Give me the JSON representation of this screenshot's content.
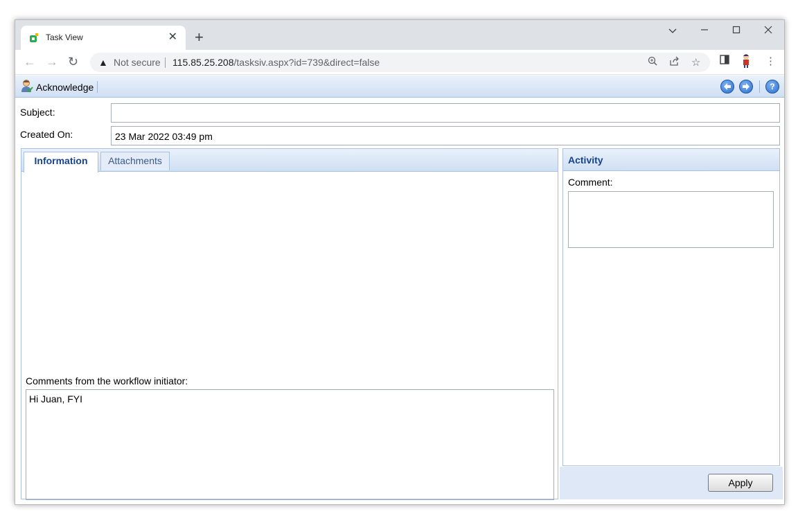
{
  "browser": {
    "tab_title": "Task View",
    "tab_close": "✕",
    "new_tab": "+",
    "security_label": "Not secure",
    "url_host": "115.85.25.208",
    "url_path": "/tasksiv.aspx?id=739&direct=false"
  },
  "toolbar": {
    "acknowledge_label": "Acknowledge"
  },
  "form": {
    "subject_label": "Subject:",
    "subject_value": "",
    "created_label": "Created On:",
    "created_value": "23 Mar 2022 03:49 pm"
  },
  "tabs": [
    {
      "label": "Information",
      "active": true
    },
    {
      "label": "Attachments",
      "active": false
    }
  ],
  "information": {
    "comments_label": "Comments from the workflow initiator:",
    "comments_value": "Hi Juan, FYI"
  },
  "activity": {
    "title": "Activity",
    "comment_label": "Comment:",
    "comment_value": "",
    "apply_label": "Apply"
  },
  "colors": {
    "accent": "#15428b",
    "panel_border": "#a9c0de",
    "header_gradient_top": "#eaf1fb",
    "header_gradient_bottom": "#cfdff3"
  }
}
